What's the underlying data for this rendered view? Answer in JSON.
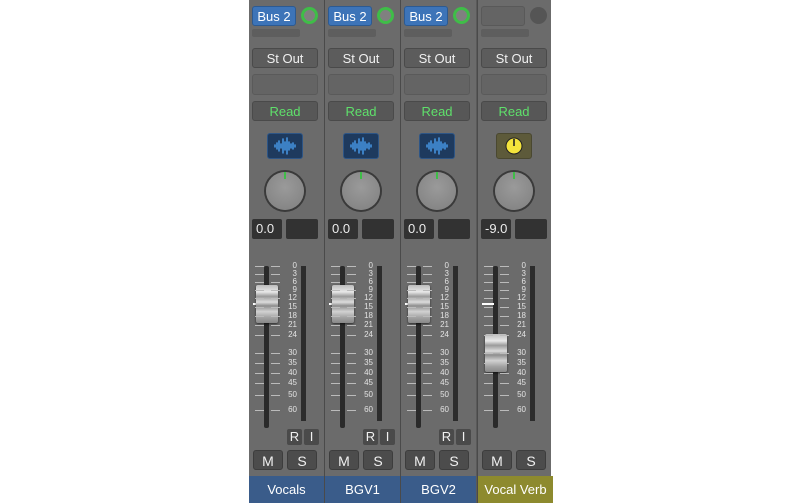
{
  "colors": {
    "audio_name_bg": "#3a5c8a",
    "aux_name_bg": "#8d8a2e",
    "bus_button": "#3d74b8",
    "read_text": "#5fe06b",
    "send_knob": "#3fbd48",
    "aux_icon": "#f4e43c"
  },
  "scale_marks": [
    "0",
    "3",
    "6",
    "9",
    "12",
    "15",
    "18",
    "21",
    "24",
    "30",
    "35",
    "40",
    "45",
    "50",
    "60"
  ],
  "strips": [
    {
      "name": "Vocals",
      "send": "Bus 2",
      "output": "St Out",
      "automation": "Read",
      "volume": "0.0",
      "peak": "",
      "record": "R",
      "input": "I",
      "mute": "M",
      "solo": "S",
      "type_icon": "waveform-icon"
    },
    {
      "name": "BGV1",
      "send": "Bus 2",
      "output": "St Out",
      "automation": "Read",
      "volume": "0.0",
      "peak": "",
      "record": "R",
      "input": "I",
      "mute": "M",
      "solo": "S",
      "type_icon": "waveform-icon"
    },
    {
      "name": "BGV2",
      "send": "Bus 2",
      "output": "St Out",
      "automation": "Read",
      "volume": "0.0",
      "peak": "",
      "record": "R",
      "input": "I",
      "mute": "M",
      "solo": "S",
      "type_icon": "waveform-icon"
    },
    {
      "name": "Vocal Verb",
      "send": "",
      "output": "St Out",
      "automation": "Read",
      "volume": "-9.0",
      "peak": "",
      "mute": "M",
      "solo": "S",
      "type_icon": "aux-knob-icon"
    }
  ]
}
